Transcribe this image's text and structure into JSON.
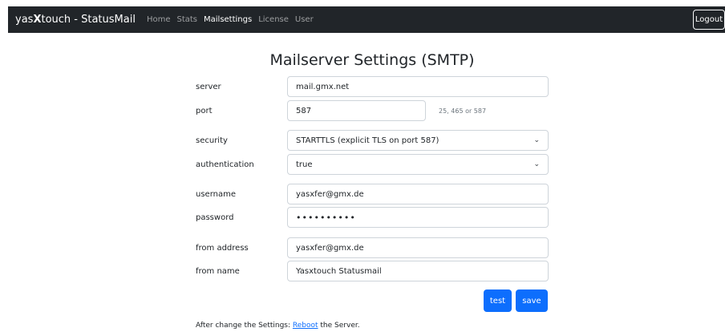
{
  "nav": {
    "brand_prefix": "yas",
    "brand_bold": "X",
    "brand_suffix": "touch - StatusMail",
    "links": [
      "Home",
      "Stats",
      "Mailsettings",
      "License",
      "User"
    ],
    "logout_label": "Logout"
  },
  "page_title": "Mailserver Settings (SMTP)",
  "form": {
    "server": {
      "label": "server",
      "value": "mail.gmx.net"
    },
    "port": {
      "label": "port",
      "value": "587",
      "hint": "25, 465 or 587"
    },
    "security": {
      "label": "security",
      "value": "STARTTLS (explicit TLS on port 587)"
    },
    "authentication": {
      "label": "authentication",
      "value": "true"
    },
    "username": {
      "label": "username",
      "value": "yasxfer@gmx.de"
    },
    "password": {
      "label": "password",
      "value": "••••••••••"
    },
    "from_address": {
      "label": "from address",
      "value": "yasxfer@gmx.de"
    },
    "from_name": {
      "label": "from name",
      "value": "Yasxtouch Statusmail"
    }
  },
  "buttons": {
    "test_label": "test",
    "save_label": "save"
  },
  "footer": {
    "before": "After change the Settings: ",
    "link": "Reboot",
    "after": " the Server."
  }
}
